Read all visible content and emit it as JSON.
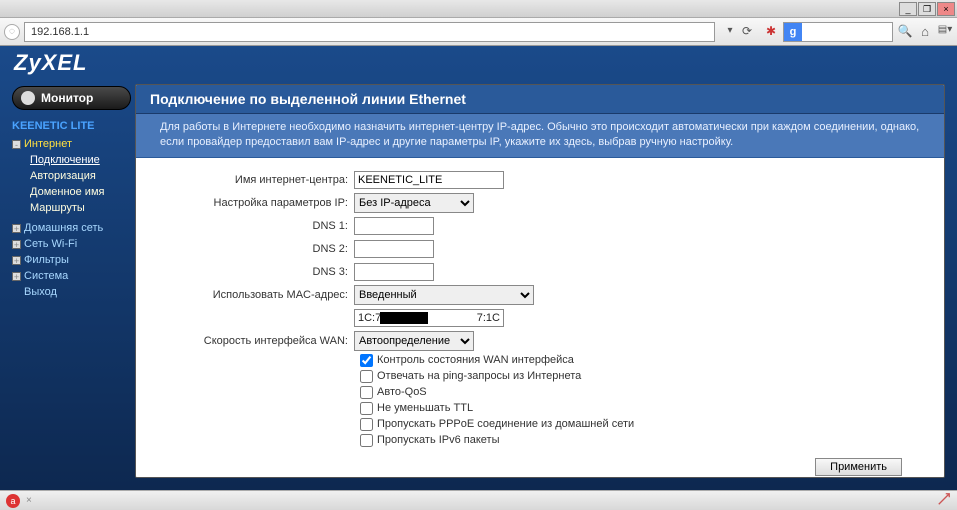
{
  "browser": {
    "url": "192.168.1.1"
  },
  "brand": "ZyXEL",
  "monitor_label": "Монитор",
  "device": "KEENETIC LITE",
  "nav": {
    "internet": "Интернет",
    "internet_sub": [
      "Подключение",
      "Авторизация",
      "Доменное имя",
      "Маршруты"
    ],
    "home_net": "Домашняя сеть",
    "wifi": "Сеть Wi-Fi",
    "filters": "Фильтры",
    "system": "Система",
    "exit": "Выход"
  },
  "page": {
    "title": "Подключение по выделенной линии Ethernet",
    "info": "Для работы в Интернете необходимо назначить интернет-центру IP-адрес. Обычно это происходит автоматически при каждом соединении, однако, если провайдер предоставил вам IP-адрес и другие параметры IP, укажите их здесь, выбрав ручную настройку."
  },
  "form": {
    "labels": {
      "name": "Имя интернет-центра:",
      "ip": "Настройка параметров IP:",
      "dns1": "DNS 1:",
      "dns2": "DNS 2:",
      "dns3": "DNS 3:",
      "mac": "Использовать MAC-адрес:",
      "wan": "Скорость интерфейса WAN:"
    },
    "values": {
      "name": "KEENETIC_LITE",
      "ip_mode": "Без IP-адреса",
      "dns1": "",
      "dns2": "",
      "dns3": "",
      "mac_mode": "Введенный",
      "mac_value_visible_prefix": "1C:7",
      "mac_value_visible_suffix": "7:1C",
      "wan_speed": "Автоопределение"
    },
    "checks": {
      "wan_status": {
        "label": "Контроль состояния WAN интерфейса",
        "checked": true
      },
      "ping": {
        "label": "Отвечать на ping-запросы из Интернета",
        "checked": false
      },
      "autoqos": {
        "label": "Авто-QoS",
        "checked": false
      },
      "ttl": {
        "label": "Не уменьшать TTL",
        "checked": false
      },
      "pppoe": {
        "label": "Пропускать PPPoE соединение из домашней сети",
        "checked": false
      },
      "ipv6": {
        "label": "Пропускать IPv6 пакеты",
        "checked": false
      }
    },
    "apply": "Применить"
  }
}
